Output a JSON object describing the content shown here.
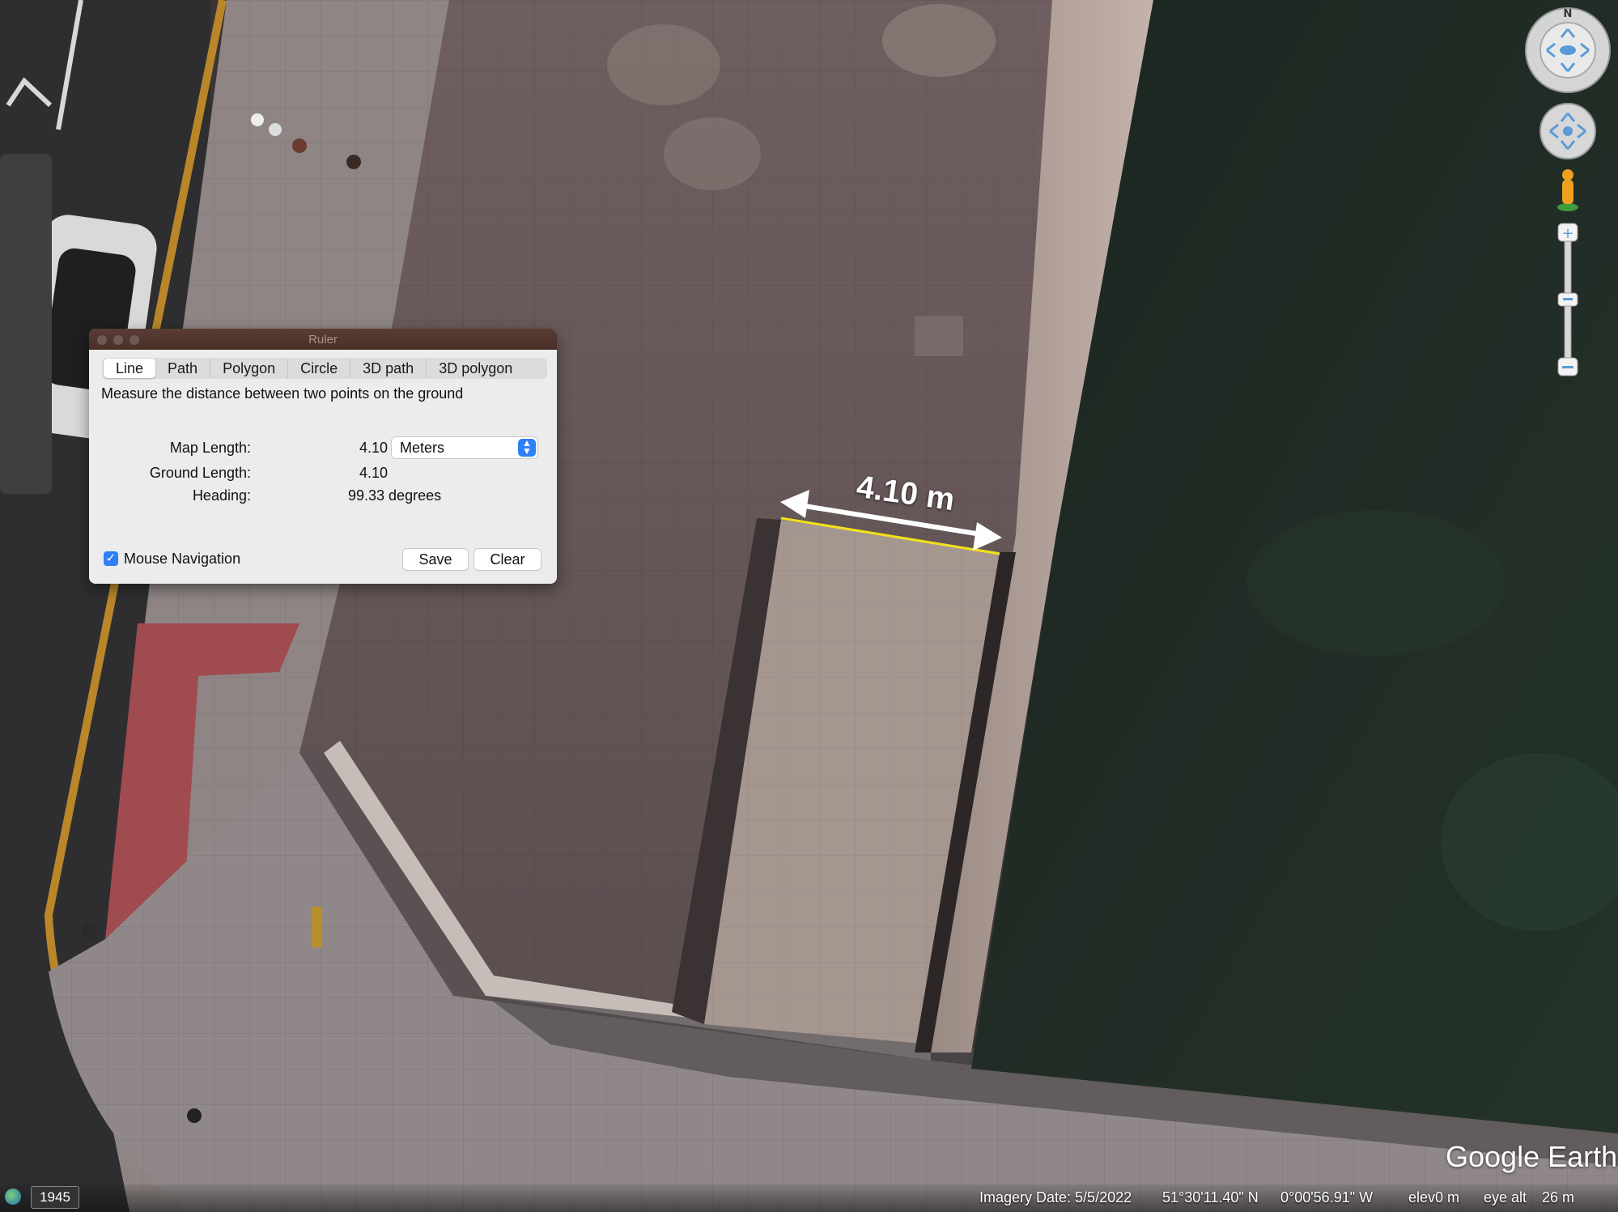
{
  "ruler": {
    "title": "Ruler",
    "tabs": [
      "Line",
      "Path",
      "Polygon",
      "Circle",
      "3D path",
      "3D polygon"
    ],
    "active_tab": "Line",
    "description": "Measure the distance between two points on the ground",
    "map_length_label": "Map Length:",
    "map_length_value": "4.10",
    "units": "Meters",
    "ground_length_label": "Ground Length:",
    "ground_length_value": "4.10",
    "heading_label": "Heading:",
    "heading_value": "99.33 degrees",
    "mouse_navigation_label": "Mouse Navigation",
    "mouse_navigation_checked": true,
    "save_label": "Save",
    "clear_label": "Clear"
  },
  "map": {
    "measurement_label": "4.10 m",
    "compass_letter": "N",
    "logo": "Google Earth"
  },
  "statusbar": {
    "year_badge": "1945",
    "imagery_date": "Imagery Date: 5/5/2022",
    "latitude": "51°30'11.40\" N",
    "longitude": "0°00'56.91\" W",
    "elev_label": "elev",
    "elev_value": "0 m",
    "eye_alt_label": "eye alt",
    "eye_alt_value": "26 m"
  },
  "colors": {
    "accent": "#2f7ff6",
    "water": "#1f2a24",
    "pavement": "#6e5f60",
    "measure_line": "#f2e21b"
  },
  "icons": [
    "look-compass-icon",
    "move-joystick-icon",
    "street-view-pegman-icon",
    "zoom-in-icon",
    "zoom-out-icon",
    "globe-icon",
    "checkbox-check-icon",
    "select-arrows-icon"
  ]
}
